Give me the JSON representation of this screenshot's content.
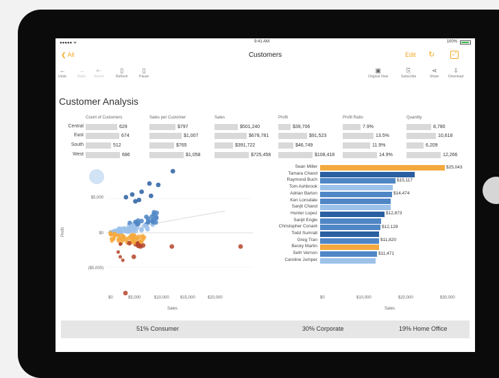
{
  "status_bar": {
    "signal": "●●●●● ᯤ",
    "time": "9:41 AM",
    "battery": "100%"
  },
  "nav": {
    "back": "All",
    "title": "Customers",
    "edit": "Edit",
    "refresh_icon": "refresh-icon",
    "fullscreen_icon": "fullscreen-icon"
  },
  "toolbar": {
    "left": [
      {
        "label": "Undo",
        "icon": "undo-icon",
        "enabled": true
      },
      {
        "label": "Redo",
        "icon": "redo-icon",
        "enabled": false
      },
      {
        "label": "Revert",
        "icon": "revert-icon",
        "enabled": false
      },
      {
        "label": "Refresh",
        "icon": "refresh-icon",
        "enabled": true
      },
      {
        "label": "Pause",
        "icon": "pause-icon",
        "enabled": true
      }
    ],
    "right": [
      {
        "label": "Original View",
        "icon": "original-view-icon"
      },
      {
        "label": "Subscribe",
        "icon": "subscribe-icon"
      },
      {
        "label": "Share",
        "icon": "share-icon"
      },
      {
        "label": "Download",
        "icon": "download-icon"
      }
    ]
  },
  "dashboard_title": "Customer Analysis",
  "colors": {
    "orange": "#f4a93e",
    "blue_dark": "#2a5fa2",
    "blue_mid": "#4f86c6",
    "blue_light": "#9dc2ea",
    "bar_grey": "#d9d9d9",
    "scatter_red": "#b5452b"
  },
  "chart_data": [
    {
      "type": "table",
      "title": "Region summary",
      "columns": [
        "Count of Customers",
        "Sales per Customer",
        "Sales",
        "Profit",
        "Profit Ratio",
        "Quantity"
      ],
      "rows": [
        {
          "region": "Central",
          "values": [
            "629",
            "$797",
            "$501,240",
            "$39,706",
            "7.9%",
            "8,780"
          ],
          "numbers": [
            629,
            797,
            501240,
            39706,
            7.9,
            8780
          ]
        },
        {
          "region": "East",
          "values": [
            "674",
            "$1,007",
            "$678,781",
            "$91,523",
            "13.5%",
            "10,618"
          ],
          "numbers": [
            674,
            1007,
            678781,
            91523,
            13.5,
            10618
          ]
        },
        {
          "region": "South",
          "values": [
            "512",
            "$765",
            "$391,722",
            "$46,749",
            "11.9%",
            "6,209"
          ],
          "numbers": [
            512,
            765,
            391722,
            46749,
            11.9,
            6209
          ]
        },
        {
          "region": "West",
          "values": [
            "686",
            "$1,058",
            "$725,458",
            "$108,418",
            "14.9%",
            "12,266"
          ],
          "numbers": [
            686,
            1058,
            725458,
            108418,
            14.9,
            12266
          ]
        }
      ]
    },
    {
      "type": "scatter",
      "xlabel": "Sales",
      "ylabel": "Profit",
      "x_ticks": [
        "$0",
        "$5,000",
        "$10,000",
        "$15,000",
        "$20,000"
      ],
      "y_ticks": [
        "$5,000",
        "$0",
        "($5,000)"
      ],
      "xlim": [
        0,
        25000
      ],
      "ylim": [
        -9000,
        12000
      ]
    },
    {
      "type": "bar",
      "orientation": "horizontal",
      "xlabel": "Sales",
      "x_ticks": [
        "$0",
        "$10,000",
        "$20,000",
        "$30,000"
      ],
      "xlim": [
        0,
        30000
      ],
      "categories": [
        "Sean Miller",
        "Tamara Chand",
        "Raymond Buch",
        "Tom Ashbrook",
        "Adrian Barton",
        "Ken Lonsdale",
        "Sanjit Chand",
        "Hunter Lopez",
        "Sanjit Engle",
        "Christopher Conant",
        "Todd Sumrall",
        "Greg Tran",
        "Becky Martin",
        "Seth Vernon",
        "Caroline Jumper"
      ],
      "values": [
        25043,
        19052,
        15117,
        14596,
        14474,
        14175,
        14142,
        12873,
        12209,
        12129,
        11891,
        11820,
        11790,
        11471,
        11165
      ],
      "labels": [
        "$25,043",
        "",
        "$15,117",
        "",
        "$14,474",
        "",
        "",
        "$12,873",
        "",
        "$12,129",
        "",
        "$11,820",
        "",
        "$11,471",
        ""
      ],
      "segments": [
        "Consumer",
        "Corporate",
        "Consumer",
        "Home Office",
        "Consumer",
        "Consumer",
        "Home Office",
        "Corporate",
        "Consumer",
        "Consumer",
        "Corporate",
        "Consumer",
        "Consumer",
        "Consumer",
        "Home Office"
      ]
    }
  ],
  "footer": {
    "consumer": "51% Consumer",
    "corporate": "30% Corporate",
    "home_office": "19% Home Office"
  }
}
